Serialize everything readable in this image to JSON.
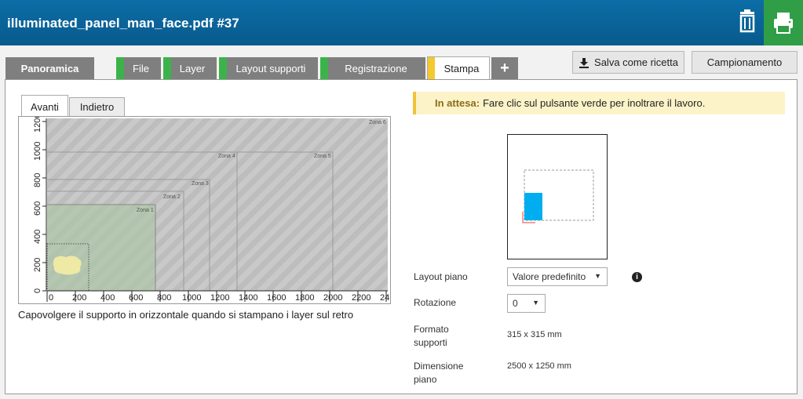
{
  "header": {
    "title": "illuminated_panel_man_face.pdf #37",
    "trash_icon": "trash-icon",
    "print_icon": "printer-icon",
    "accent": "#0c6da6",
    "print_color": "#2f9e47"
  },
  "tabs": [
    {
      "label": "Panoramica"
    },
    {
      "label": "File"
    },
    {
      "label": "Layer"
    },
    {
      "label": "Layout supporti"
    },
    {
      "label": "Registrazione"
    },
    {
      "label": "Stampa"
    },
    {
      "label": "+"
    }
  ],
  "toolbar": {
    "save_recipe_label": "Salva come ricetta",
    "sampling_label": "Campionamento"
  },
  "subtabs": [
    {
      "label": "Avanti"
    },
    {
      "label": "Indietro"
    }
  ],
  "canvas": {
    "y_ticks": [
      "0",
      "200",
      "400",
      "600",
      "800",
      "1000",
      "1200"
    ],
    "x_ticks": [
      "0",
      "200",
      "400",
      "600",
      "800",
      "1000",
      "1200",
      "1400",
      "1600",
      "1800",
      "2000",
      "2200",
      "24"
    ],
    "zones": [
      "Zona 1",
      "Zona 2",
      "Zona 3",
      "Zona 4",
      "Zona 5",
      "Zona 6"
    ],
    "caption": "Capovolgere il supporto in orizzontale quando si stampano i layer sul retro"
  },
  "status": {
    "prefix": "In attesa:",
    "message": "Fare clic sul pulsante verde per inoltrare il lavoro."
  },
  "fields": {
    "layout_piano_label": "Layout piano",
    "layout_piano_value": "Valore predefinito",
    "rotazione_label": "Rotazione",
    "rotazione_value": "0",
    "formato_label_1": "Formato",
    "formato_label_2": "supporti",
    "formato_value": "315 x 315 mm",
    "dimensione_label_1": "Dimensione",
    "dimensione_label_2": "piano",
    "dimensione_value": "2500 x 1250 mm"
  }
}
